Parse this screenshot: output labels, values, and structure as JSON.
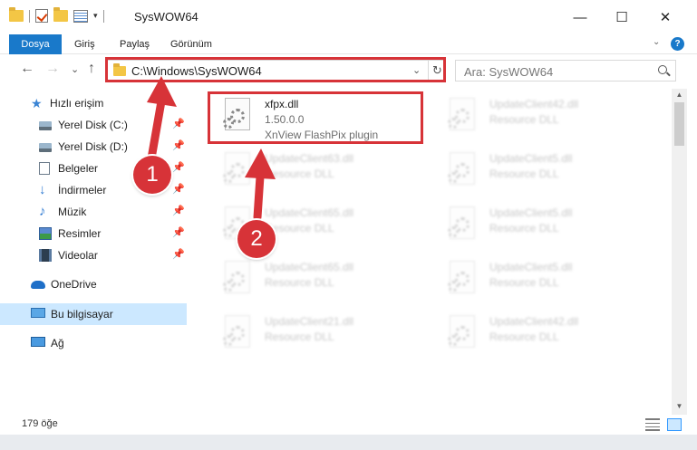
{
  "window": {
    "title": "SysWOW64",
    "minimize_glyph": "—",
    "maximize_glyph": "☐",
    "close_glyph": "✕"
  },
  "ribbon": {
    "tabs": [
      "Dosya",
      "Giriş",
      "Paylaş",
      "Görünüm"
    ],
    "help_glyph": "?"
  },
  "navigation": {
    "back_glyph": "←",
    "forward_glyph": "→",
    "recent_glyph": "⌄",
    "up_glyph": "↑",
    "address": "C:\\Windows\\SysWOW64",
    "refresh_glyph": "↻",
    "search_placeholder": "Ara: SysWOW64"
  },
  "sidebar": {
    "items": [
      {
        "label": "Hızlı erişim",
        "icon": "star-icon"
      },
      {
        "label": "Yerel Disk (C:)",
        "icon": "drive-icon"
      },
      {
        "label": "Yerel Disk (D:)",
        "icon": "drive-icon"
      },
      {
        "label": "Belgeler",
        "icon": "documents-icon"
      },
      {
        "label": "İndirmeler",
        "icon": "downloads-icon"
      },
      {
        "label": "Müzik",
        "icon": "music-icon"
      },
      {
        "label": "Resimler",
        "icon": "pictures-icon"
      },
      {
        "label": "Videolar",
        "icon": "videos-icon"
      },
      {
        "label": "OneDrive",
        "icon": "cloud-icon"
      },
      {
        "label": "Bu bilgisayar",
        "icon": "computer-icon"
      },
      {
        "label": "Ağ",
        "icon": "network-icon"
      }
    ]
  },
  "files": [
    {
      "name": "xfpx.dll",
      "version": "1.50.0.0",
      "description": "XnView FlashPix plugin"
    },
    {
      "name": "UpdateClient42.dll",
      "type": "Resource DLL"
    },
    {
      "name": "UpdateClient63.dll",
      "type": "Resource DLL"
    },
    {
      "name": "UpdateClient5.dll",
      "type": "Resource DLL"
    },
    {
      "name": "UpdateClient65.dll",
      "type": "Resource DLL"
    },
    {
      "name": "UpdateClient5.dll",
      "type": "Resource DLL"
    },
    {
      "name": "UpdateClient65.dll",
      "type": "Resource DLL"
    },
    {
      "name": "UpdateClient5.dll",
      "type": "Resource DLL"
    },
    {
      "name": "UpdateClient21.dll",
      "type": "Resource DLL"
    },
    {
      "name": "UpdateClient42.dll",
      "type": "Resource DLL"
    }
  ],
  "status": {
    "item_count": "179 öğe"
  },
  "annotations": {
    "step1": "1",
    "step2": "2",
    "color": "#d73338"
  },
  "colors": {
    "accent": "#1979ca",
    "selection": "#cce8ff",
    "highlight": "#d73338"
  }
}
